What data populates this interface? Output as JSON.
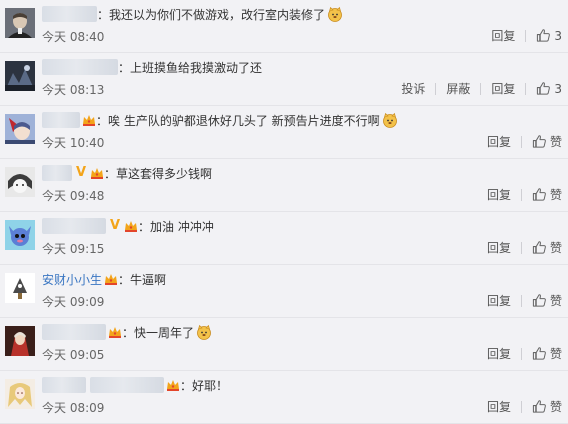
{
  "comments": [
    {
      "name": "",
      "text": "：我还以为你们不做游戏，改行室内装修了",
      "time": "今天 08:40",
      "actions": [
        "回复"
      ],
      "like": "3"
    },
    {
      "name": "",
      "text": "：上班摸鱼给我摸激动了还",
      "time": "今天 08:13",
      "actions": [
        "投诉",
        "屏蔽",
        "回复"
      ],
      "like": "3"
    },
    {
      "name": "",
      "text": "：唉 生产队的驴都退休好几头了 新预告片进度不行啊",
      "time": "今天 10:40",
      "actions": [
        "回复"
      ],
      "like": "赞"
    },
    {
      "name": "",
      "text": "：草这套得多少钱啊",
      "time": "今天 09:48",
      "actions": [
        "回复"
      ],
      "like": "赞"
    },
    {
      "name": "",
      "text": "：加油 冲冲冲",
      "time": "今天 09:15",
      "actions": [
        "回复"
      ],
      "like": "赞"
    },
    {
      "name": "安财小小生",
      "text": "：牛逼啊",
      "time": "今天 09:09",
      "actions": [
        "回复"
      ],
      "like": "赞"
    },
    {
      "name": "",
      "text": "：快一周年了",
      "time": "今天 09:05",
      "actions": [
        "回复"
      ],
      "like": "赞"
    },
    {
      "name": "",
      "text": "：好耶！",
      "time": "今天 08:09",
      "actions": [
        "回复"
      ],
      "like": "赞"
    }
  ],
  "icons": {
    "like": "thumbs-up-icon",
    "emoji": "doge-emoji-icon",
    "member": "member-badge-icon",
    "verified": "verified-v-icon"
  },
  "colors": {
    "username": "#3a76c2",
    "verified": "#f3a41a",
    "member": "#f3a41a"
  }
}
